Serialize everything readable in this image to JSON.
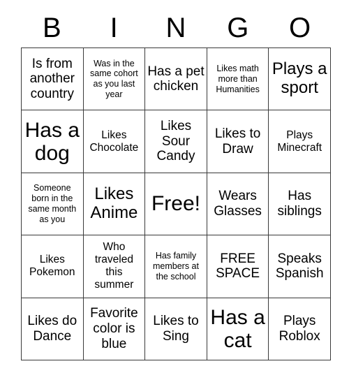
{
  "header": {
    "letters": [
      "B",
      "I",
      "N",
      "G",
      "O"
    ]
  },
  "grid": {
    "rows": [
      [
        {
          "text": "Is from another country",
          "size": "md"
        },
        {
          "text": "Was in the same cohort as you last year",
          "size": "xs"
        },
        {
          "text": "Has a pet chicken",
          "size": "md"
        },
        {
          "text": "Likes math more than Humanities",
          "size": "xs"
        },
        {
          "text": "Plays a sport",
          "size": "lg"
        }
      ],
      [
        {
          "text": "Has a dog",
          "size": "xl"
        },
        {
          "text": "Likes Chocolate",
          "size": "sm"
        },
        {
          "text": "Likes Sour Candy",
          "size": "md"
        },
        {
          "text": "Likes to Draw",
          "size": "md"
        },
        {
          "text": "Plays Minecraft",
          "size": "sm"
        }
      ],
      [
        {
          "text": "Someone born in the same month as you",
          "size": "xs"
        },
        {
          "text": "Likes Anime",
          "size": "lg"
        },
        {
          "text": "Free!",
          "size": "xl"
        },
        {
          "text": "Wears Glasses",
          "size": "md"
        },
        {
          "text": "Has siblings",
          "size": "md"
        }
      ],
      [
        {
          "text": "Likes Pokemon",
          "size": "sm"
        },
        {
          "text": "Who traveled this summer",
          "size": "sm"
        },
        {
          "text": "Has family members at the school",
          "size": "xs"
        },
        {
          "text": "FREE SPACE",
          "size": "md"
        },
        {
          "text": "Speaks Spanish",
          "size": "md"
        }
      ],
      [
        {
          "text": "Likes do Dance",
          "size": "md"
        },
        {
          "text": "Favorite color is blue",
          "size": "md"
        },
        {
          "text": "Likes to Sing",
          "size": "md"
        },
        {
          "text": "Has a cat",
          "size": "xl"
        },
        {
          "text": "Plays Roblox",
          "size": "md"
        }
      ]
    ]
  },
  "colors": {
    "background": "#ffffff",
    "text": "#000000",
    "border": "#3a3a3a"
  }
}
